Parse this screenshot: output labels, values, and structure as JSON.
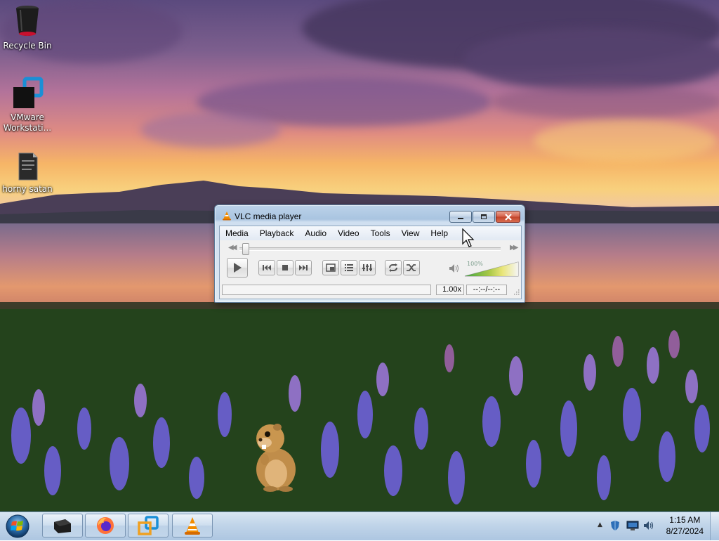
{
  "desktop": {
    "icons": [
      {
        "label": "Recycle Bin",
        "icon": "recycle-bin-icon"
      },
      {
        "label": "VMware Workstati...",
        "icon": "vmware-icon"
      },
      {
        "label": "horny satan",
        "icon": "document-icon"
      }
    ]
  },
  "vlc": {
    "title": "VLC media player",
    "menu": [
      "Media",
      "Playback",
      "Audio",
      "Video",
      "Tools",
      "View",
      "Help"
    ],
    "volume_label": "100%",
    "volume_level": 1.0,
    "speed": "1.00x",
    "time": "--:--/--:--",
    "position": 0.0
  },
  "taskbar": {
    "pinned": [
      "terminal-icon",
      "firefox-icon",
      "vmware-icon",
      "vlc-icon"
    ],
    "clock_time": "1:15 AM",
    "clock_date": "8/27/2024"
  },
  "colors": {
    "accent": "#3f6fa5",
    "close_red": "#c2432a",
    "vlc_orange": "#f28c00"
  }
}
